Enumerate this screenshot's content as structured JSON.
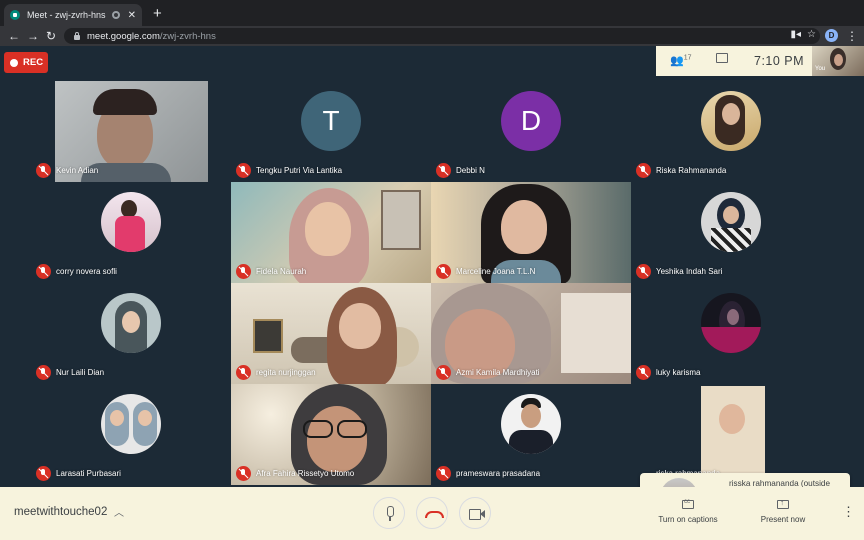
{
  "browser": {
    "tab_title": "Meet - zwj-zvrh-hns",
    "tab_close": "✕",
    "new_tab": "+",
    "url_domain": "meet.google.com",
    "url_path": "/zwj-zvrh-hns",
    "profile_initial": "D"
  },
  "meet": {
    "rec_label": "REC",
    "participant_count": "17",
    "time": "7:10 PM",
    "self_label": "You",
    "participants": [
      {
        "name": "Kevin Adian",
        "kind": "video"
      },
      {
        "name": "Tengku Putri Via Lantika",
        "kind": "letter",
        "letter": "T",
        "color": "#3f6578"
      },
      {
        "name": "Debbi N",
        "kind": "letter",
        "letter": "D",
        "color": "#7b2fa6"
      },
      {
        "name": "Riska Rahmananda",
        "kind": "avatar"
      },
      {
        "name": "corry novera sofli",
        "kind": "avatar"
      },
      {
        "name": "Fidela Naurah",
        "kind": "video"
      },
      {
        "name": "Marceline Joana T.L.N",
        "kind": "video"
      },
      {
        "name": "Yeshika Indah Sari",
        "kind": "avatar"
      },
      {
        "name": "Nur Laili Dian",
        "kind": "avatar"
      },
      {
        "name": "regita nurjinggan",
        "kind": "video"
      },
      {
        "name": "Azmi Kamila Mardhiyati",
        "kind": "video"
      },
      {
        "name": "luky karisma",
        "kind": "avatar"
      },
      {
        "name": "Larasati Purbasari",
        "kind": "avatar"
      },
      {
        "name": "Afra Fahira Rissetyo Utomo",
        "kind": "video"
      },
      {
        "name": "prameswara prasadana",
        "kind": "avatar"
      },
      {
        "name": "riska rahmananda",
        "kind": "video"
      }
    ],
    "notification": {
      "text": "risska rahmananda (outside Universitas Gadjah Mada) joined"
    }
  },
  "bottom": {
    "meeting_name": "meetwithtouche02",
    "captions_label": "Turn on captions",
    "present_label": "Present now"
  }
}
